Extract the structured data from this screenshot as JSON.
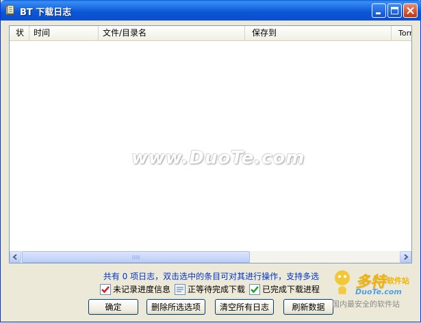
{
  "window": {
    "title": "BT 下载日志"
  },
  "list": {
    "columns": [
      "状",
      "时间",
      "文件/目录名",
      "保存到",
      "Torr"
    ],
    "rows": [],
    "watermark": "www.DuoTe.com"
  },
  "summary": "共有 0 项日志，双击选中的条目可对其进行操作，支持多选",
  "legend": [
    {
      "label": "未记录进度信息",
      "icon": "red-check-icon"
    },
    {
      "label": "正等待完成下载",
      "icon": "pending-icon"
    },
    {
      "label": "已完成下载进程",
      "icon": "green-check-icon"
    }
  ],
  "buttons": {
    "ok": "确定",
    "delete_selected": "删除所选选项",
    "clear_all": "清空所有日志",
    "refresh": "刷新数据"
  },
  "brand": {
    "name_big": "多特",
    "name_small": "软件站",
    "site": "DuoTe.com",
    "tagline": "国内最安全的软件站"
  },
  "colors": {
    "title_bar": "#0a55d4",
    "summary_text": "#0033cc",
    "logo": "#f2b300"
  }
}
